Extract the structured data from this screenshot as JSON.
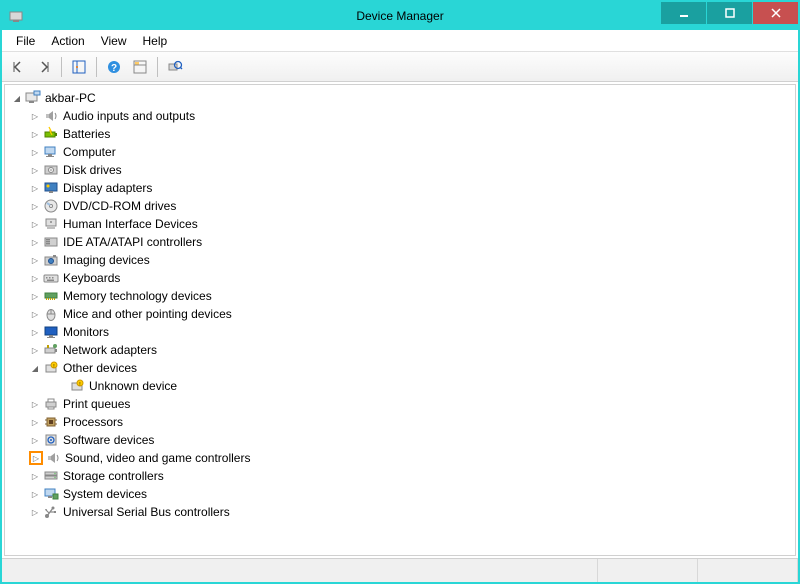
{
  "window": {
    "title": "Device Manager"
  },
  "menu": {
    "file": "File",
    "action": "Action",
    "view": "View",
    "help": "Help"
  },
  "tree": {
    "root": "akbar-PC",
    "items": [
      {
        "label": "Audio inputs and outputs",
        "icon": "speaker"
      },
      {
        "label": "Batteries",
        "icon": "battery"
      },
      {
        "label": "Computer",
        "icon": "computer"
      },
      {
        "label": "Disk drives",
        "icon": "disk"
      },
      {
        "label": "Display adapters",
        "icon": "display"
      },
      {
        "label": "DVD/CD-ROM drives",
        "icon": "cd"
      },
      {
        "label": "Human Interface Devices",
        "icon": "hid"
      },
      {
        "label": "IDE ATA/ATAPI controllers",
        "icon": "ide"
      },
      {
        "label": "Imaging devices",
        "icon": "camera"
      },
      {
        "label": "Keyboards",
        "icon": "keyboard"
      },
      {
        "label": "Memory technology devices",
        "icon": "memory"
      },
      {
        "label": "Mice and other pointing devices",
        "icon": "mouse"
      },
      {
        "label": "Monitors",
        "icon": "monitor"
      },
      {
        "label": "Network adapters",
        "icon": "network"
      },
      {
        "label": "Other devices",
        "icon": "other",
        "expanded": true,
        "children": [
          {
            "label": "Unknown device",
            "icon": "unknown"
          }
        ]
      },
      {
        "label": "Print queues",
        "icon": "printer"
      },
      {
        "label": "Processors",
        "icon": "cpu"
      },
      {
        "label": "Software devices",
        "icon": "software"
      },
      {
        "label": "Sound, video and game controllers",
        "icon": "speaker",
        "highlight": true
      },
      {
        "label": "Storage controllers",
        "icon": "storage"
      },
      {
        "label": "System devices",
        "icon": "system"
      },
      {
        "label": "Universal Serial Bus controllers",
        "icon": "usb"
      }
    ]
  }
}
